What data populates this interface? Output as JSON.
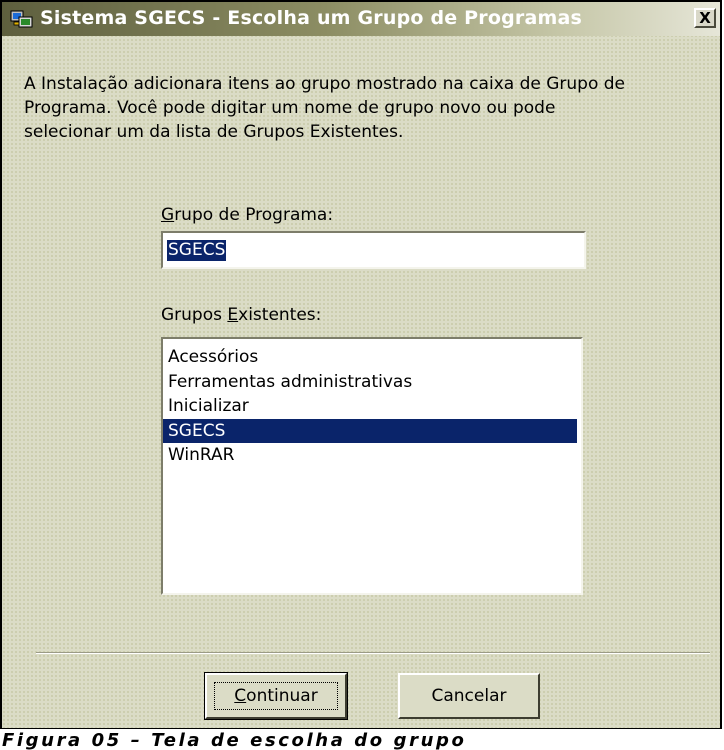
{
  "window": {
    "title": "Sistema SGECS - Escolha um Grupo de Programas",
    "close_label": "X",
    "icon": "setup-app-icon"
  },
  "intro_text": "A Instalação adicionara itens ao grupo mostrado na caixa de Grupo de\nPrograma.  Você pode digitar um nome de grupo novo ou pode\nselecionar um da lista de Grupos Existentes.",
  "program_group": {
    "label_accel": "G",
    "label_rest": "rupo de Programa:",
    "value": "SGECS"
  },
  "existing_groups": {
    "label_pre": "Grupos ",
    "label_accel": "E",
    "label_post": "xistentes:",
    "items": [
      "Acessórios",
      "Ferramentas administrativas",
      "Inicializar",
      "SGECS",
      "WinRAR"
    ],
    "selected": "SGECS"
  },
  "buttons": {
    "continue_accel": "C",
    "continue_rest": "ontinuar",
    "cancel": "Cancelar"
  },
  "caption": "Figura 05 – Tela de escolha do grupo",
  "colors": {
    "selection": "#0a246a",
    "dialog_bg": "#dbdcc6",
    "titlebar_dark": "#5e5f3e"
  }
}
